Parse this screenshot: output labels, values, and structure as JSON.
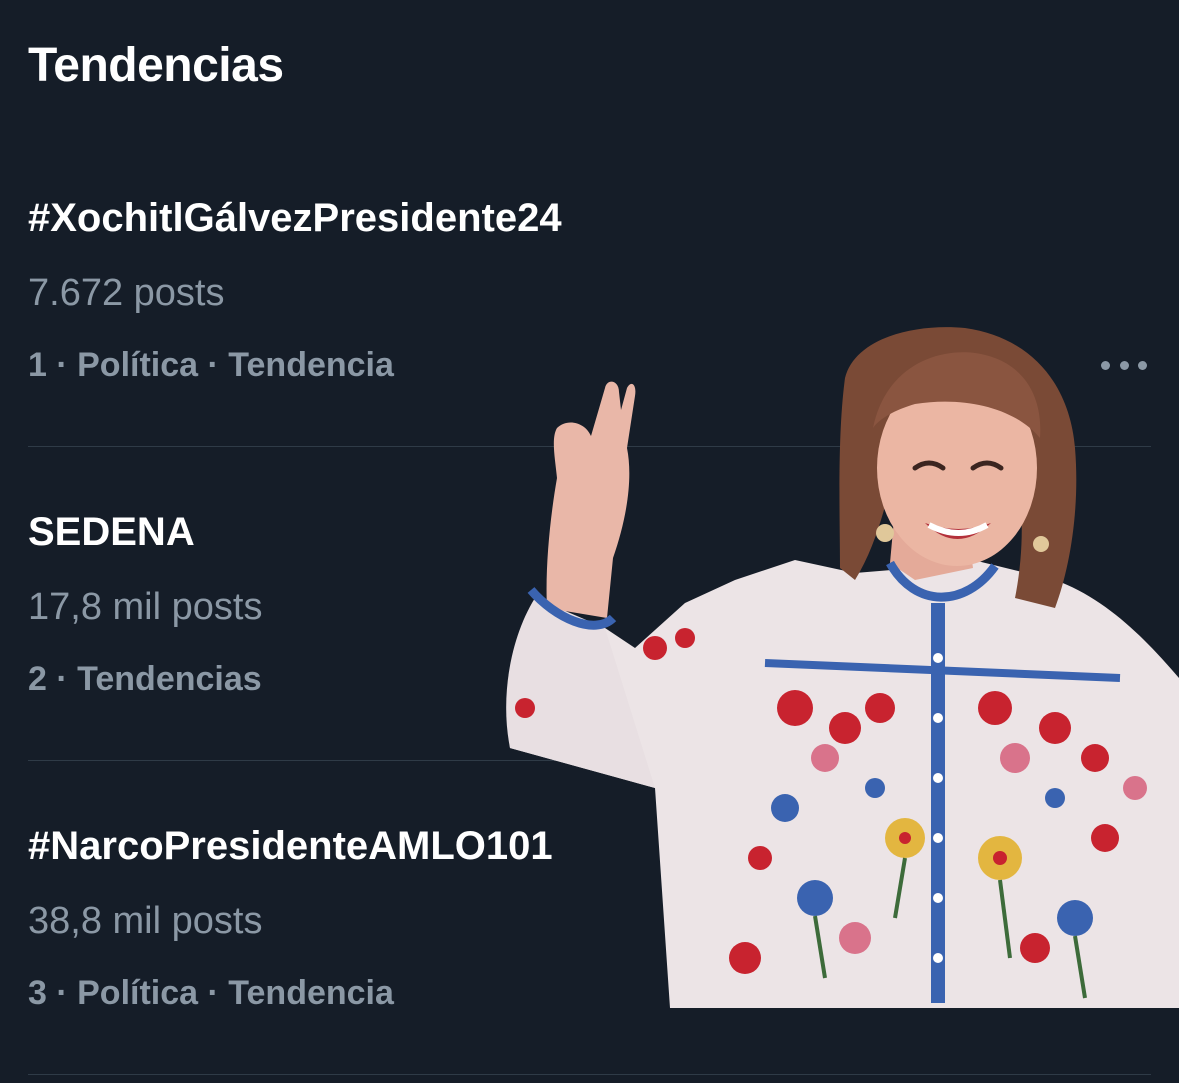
{
  "section": {
    "title": "Tendencias"
  },
  "trends": [
    {
      "name": "#XochitlGálvezPresidente24",
      "count": "7.672 posts",
      "meta": "1 · Política · Tendencia"
    },
    {
      "name": "SEDENA",
      "count": "17,8 mil posts",
      "meta": "2 · Tendencias"
    },
    {
      "name": "#NarcoPresidenteAMLO101",
      "count": "38,8 mil posts",
      "meta": "3 · Política · Tendencia"
    }
  ],
  "icons": {
    "more": "more-horizontal-icon"
  },
  "colors": {
    "background": "#151d28",
    "primary_text": "#ffffff",
    "secondary_text": "#8b98a5",
    "divider": "#2f3b47",
    "blouse": "#ece4e6",
    "embroidery_red": "#c8232f",
    "embroidery_blue": "#3a63b0"
  }
}
